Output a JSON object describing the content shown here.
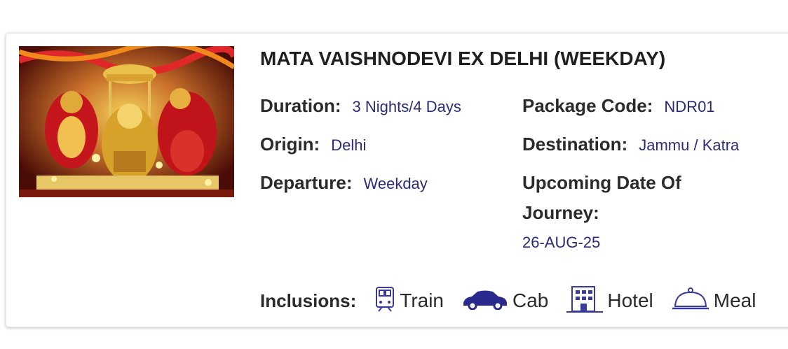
{
  "package": {
    "title": "MATA VAISHNODEVI EX DELHI (WEEKDAY)",
    "duration_label": "Duration:",
    "duration_value": "3 Nights/4 Days",
    "package_code_label": "Package Code:",
    "package_code_value": "NDR01",
    "origin_label": "Origin:",
    "origin_value": "Delhi",
    "destination_label": "Destination:",
    "destination_value": "Jammu / Katra",
    "departure_label": "Departure:",
    "departure_value": "Weekday",
    "upcoming_label": "Upcoming Date Of Journey:",
    "upcoming_value": "26-AUG-25"
  },
  "inclusions": {
    "label": "Inclusions:",
    "items": [
      {
        "name": "Train",
        "icon": "train-icon"
      },
      {
        "name": "Cab",
        "icon": "car-icon"
      },
      {
        "name": "Hotel",
        "icon": "hotel-icon"
      },
      {
        "name": "Meal",
        "icon": "meal-cloche-icon"
      }
    ]
  },
  "colors": {
    "value_text": "#2b2b7a",
    "icon": "#3a3a9a"
  }
}
